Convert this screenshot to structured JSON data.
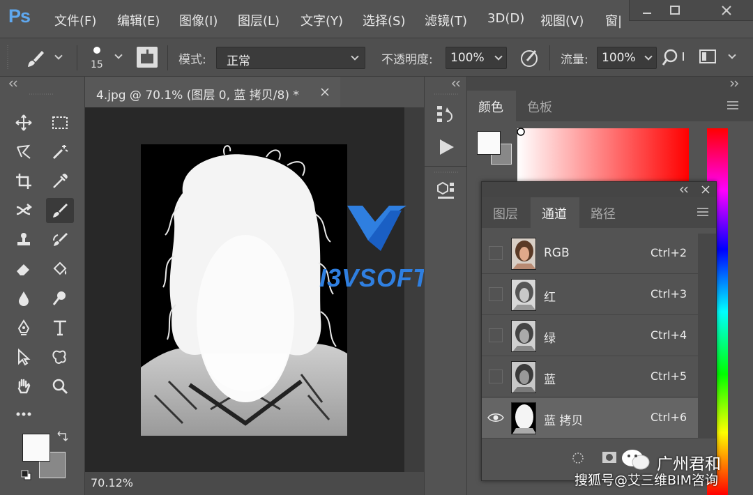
{
  "app": {
    "logo": "Ps"
  },
  "menu": [
    "文件(F)",
    "编辑(E)",
    "图像(I)",
    "图层(L)",
    "文字(Y)",
    "选择(S)",
    "滤镜(T)",
    "3D(D)",
    "视图(V)",
    "窗|"
  ],
  "options": {
    "brush_size": "15",
    "mode_label": "模式:",
    "mode_value": "正常",
    "opacity_label": "不透明度:",
    "opacity_value": "100%",
    "flow_label": "流量:",
    "flow_value": "100%"
  },
  "document": {
    "tab_title": "4.jpg @ 70.1% (图层 0, 蓝 拷贝/8) *",
    "zoom": "70.12%"
  },
  "color_panel": {
    "tabs": [
      "颜色",
      "色板"
    ]
  },
  "channels_panel": {
    "tabs": [
      "图层",
      "通道",
      "路径"
    ],
    "channels": [
      {
        "name": "RGB",
        "shortcut": "Ctrl+2",
        "visible": false,
        "selected": false
      },
      {
        "name": "红",
        "shortcut": "Ctrl+3",
        "visible": false,
        "selected": false
      },
      {
        "name": "绿",
        "shortcut": "Ctrl+4",
        "visible": false,
        "selected": false
      },
      {
        "name": "蓝",
        "shortcut": "Ctrl+5",
        "visible": false,
        "selected": false
      },
      {
        "name": "蓝 拷贝",
        "shortcut": "Ctrl+6",
        "visible": true,
        "selected": true
      }
    ]
  },
  "watermark": {
    "text": "I3VSOFT"
  },
  "credits": {
    "line1": "广州君和",
    "line2": "搜狐号@艾三维BIM咨询"
  },
  "colors": {
    "accent": "#2f7fe0",
    "ps_blue": "#5fa8ef"
  }
}
